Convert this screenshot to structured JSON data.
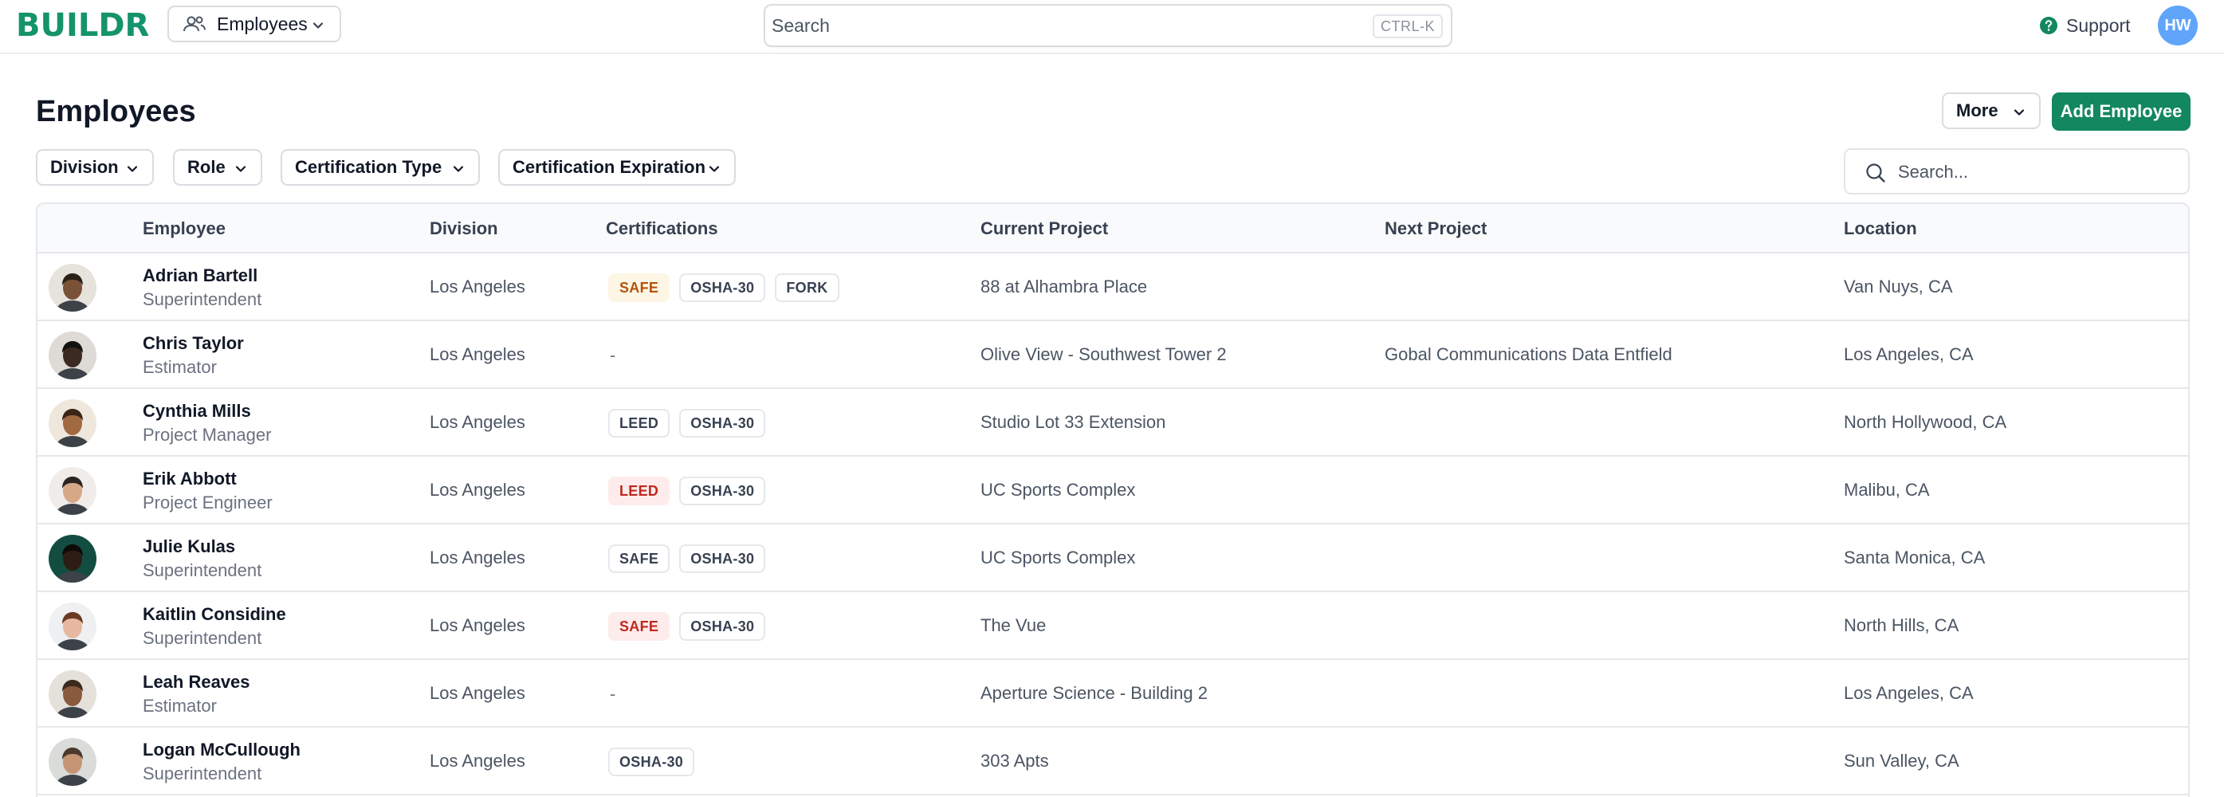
{
  "app": {
    "logo": "BUILDR",
    "switcher_label": "Employees",
    "search_placeholder": "Search",
    "search_shortcut": "CTRL-K",
    "support_label": "Support",
    "user_initials": "HW"
  },
  "colors": {
    "brand": "#15936b",
    "primary_button": "#13875f",
    "avatar": "#60a5fa",
    "warning_badge": "#fef6e4",
    "danger_badge": "#fdeceb"
  },
  "page": {
    "title": "Employees",
    "more_label": "More",
    "add_label": "Add Employee",
    "table_search_placeholder": "Search..."
  },
  "filters": [
    "Division",
    "Role",
    "Certification Type",
    "Certification Expiration"
  ],
  "table": {
    "columns": [
      "Employee",
      "Division",
      "Certifications",
      "Current Project",
      "Next Project",
      "Location"
    ],
    "rows": [
      {
        "name": "Adrian Bartell",
        "role": "Superintendent",
        "division": "Los Angeles",
        "certs": [
          {
            "label": "SAFE",
            "status": "warning"
          },
          {
            "label": "OSHA-30",
            "status": "normal"
          },
          {
            "label": "FORK",
            "status": "normal"
          }
        ],
        "current_project": "88 at Alhambra Place",
        "next_project": "",
        "location": "Van Nuys, CA"
      },
      {
        "name": "Chris Taylor",
        "role": "Estimator",
        "division": "Los Angeles",
        "certs": [],
        "current_project": "Olive View - Southwest Tower 2",
        "next_project": "Gobal Communications Data Entfield",
        "location": "Los Angeles, CA"
      },
      {
        "name": "Cynthia Mills",
        "role": "Project Manager",
        "division": "Los Angeles",
        "certs": [
          {
            "label": "LEED",
            "status": "normal"
          },
          {
            "label": "OSHA-30",
            "status": "normal"
          }
        ],
        "current_project": "Studio Lot 33 Extension",
        "next_project": "",
        "location": "North Hollywood, CA"
      },
      {
        "name": "Erik Abbott",
        "role": "Project Engineer",
        "division": "Los Angeles",
        "certs": [
          {
            "label": "LEED",
            "status": "danger"
          },
          {
            "label": "OSHA-30",
            "status": "normal"
          }
        ],
        "current_project": "UC Sports Complex",
        "next_project": "",
        "location": "Malibu, CA"
      },
      {
        "name": "Julie Kulas",
        "role": "Superintendent",
        "division": "Los Angeles",
        "certs": [
          {
            "label": "SAFE",
            "status": "normal"
          },
          {
            "label": "OSHA-30",
            "status": "normal"
          }
        ],
        "current_project": "UC Sports Complex",
        "next_project": "",
        "location": "Santa Monica, CA"
      },
      {
        "name": "Kaitlin Considine",
        "role": "Superintendent",
        "division": "Los Angeles",
        "certs": [
          {
            "label": "SAFE",
            "status": "danger"
          },
          {
            "label": "OSHA-30",
            "status": "normal"
          }
        ],
        "current_project": "The Vue",
        "next_project": "",
        "location": "North Hills, CA"
      },
      {
        "name": "Leah Reaves",
        "role": "Estimator",
        "division": "Los Angeles",
        "certs": [],
        "current_project": "Aperture Science - Building 2",
        "next_project": "",
        "location": "Los Angeles, CA"
      },
      {
        "name": "Logan McCullough",
        "role": "Superintendent",
        "division": "Los Angeles",
        "certs": [
          {
            "label": "OSHA-30",
            "status": "normal"
          }
        ],
        "current_project": "303 Apts",
        "next_project": "",
        "location": "Sun Valley, CA"
      }
    ],
    "empty_cert": "-"
  }
}
